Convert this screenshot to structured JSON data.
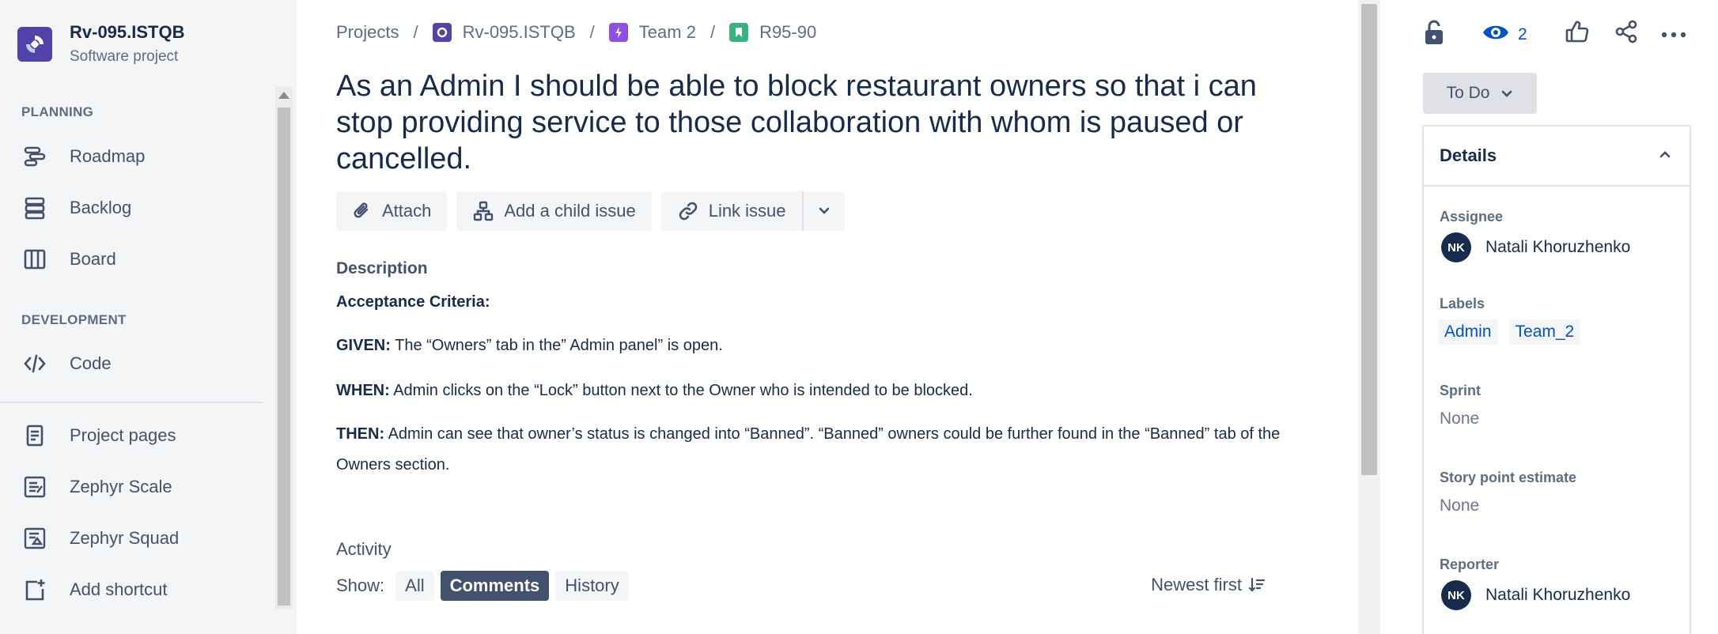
{
  "sidebar": {
    "project_name": "Rv-095.ISTQB",
    "project_type": "Software project",
    "planning_heading": "PLANNING",
    "development_heading": "DEVELOPMENT",
    "items": [
      {
        "label": "Roadmap",
        "icon": "roadmap-icon"
      },
      {
        "label": "Backlog",
        "icon": "backlog-icon"
      },
      {
        "label": "Board",
        "icon": "board-icon"
      },
      {
        "label": "Code",
        "icon": "code-icon"
      },
      {
        "label": "Project pages",
        "icon": "page-icon"
      },
      {
        "label": "Zephyr Scale",
        "icon": "zephyr-scale-icon"
      },
      {
        "label": "Zephyr Squad",
        "icon": "zephyr-squad-icon"
      },
      {
        "label": "Add shortcut",
        "icon": "add-shortcut-icon"
      }
    ]
  },
  "breadcrumb": {
    "root": "Projects",
    "project": "Rv-095.ISTQB",
    "epic": "Team 2",
    "issue": "R95-90",
    "separator": "/"
  },
  "issue": {
    "title": "As an Admin I should be able to block restaurant owners so that i can stop providing service to those collaboration with whom is paused or cancelled."
  },
  "toolbar": {
    "attach": "Attach",
    "add_child": "Add a child issue",
    "link_issue": "Link issue"
  },
  "description": {
    "label": "Description",
    "criteria_heading": "Acceptance Criteria:",
    "given_key": "GIVEN:",
    "given_text": " The “Owners” tab in the” Admin panel” is open.",
    "when_key": "WHEN:",
    "when_text": " Admin clicks on the “Lock” button next to the Owner who is intended to be blocked.",
    "then_key": "THEN:",
    "then_text": " Admin can see that owner’s status is changed into “Banned”. “Banned” owners could be further found in the “Banned” tab of the Owners section."
  },
  "activity": {
    "label": "Activity",
    "show_label": "Show:",
    "filters": [
      "All",
      "Comments",
      "History"
    ],
    "active_filter": "Comments",
    "sort_label": "Newest first"
  },
  "right_panel": {
    "watchers_count": "2",
    "status": "To Do",
    "details_heading": "Details",
    "assignee_label": "Assignee",
    "assignee_name": "Natali Khoruzhenko",
    "assignee_initials": "NK",
    "labels_label": "Labels",
    "labels": [
      "Admin",
      "Team_2"
    ],
    "sprint_label": "Sprint",
    "sprint_value": "None",
    "story_points_label": "Story point estimate",
    "story_points_value": "None",
    "reporter_label": "Reporter",
    "reporter_name": "Natali Khoruzhenko",
    "reporter_initials": "NK"
  },
  "colors": {
    "accent": "#0052cc",
    "project_logo": "#5243aa",
    "epic": "#904ee2",
    "story": "#36b37e",
    "text": "#172b4d",
    "subtle": "#42526e"
  }
}
